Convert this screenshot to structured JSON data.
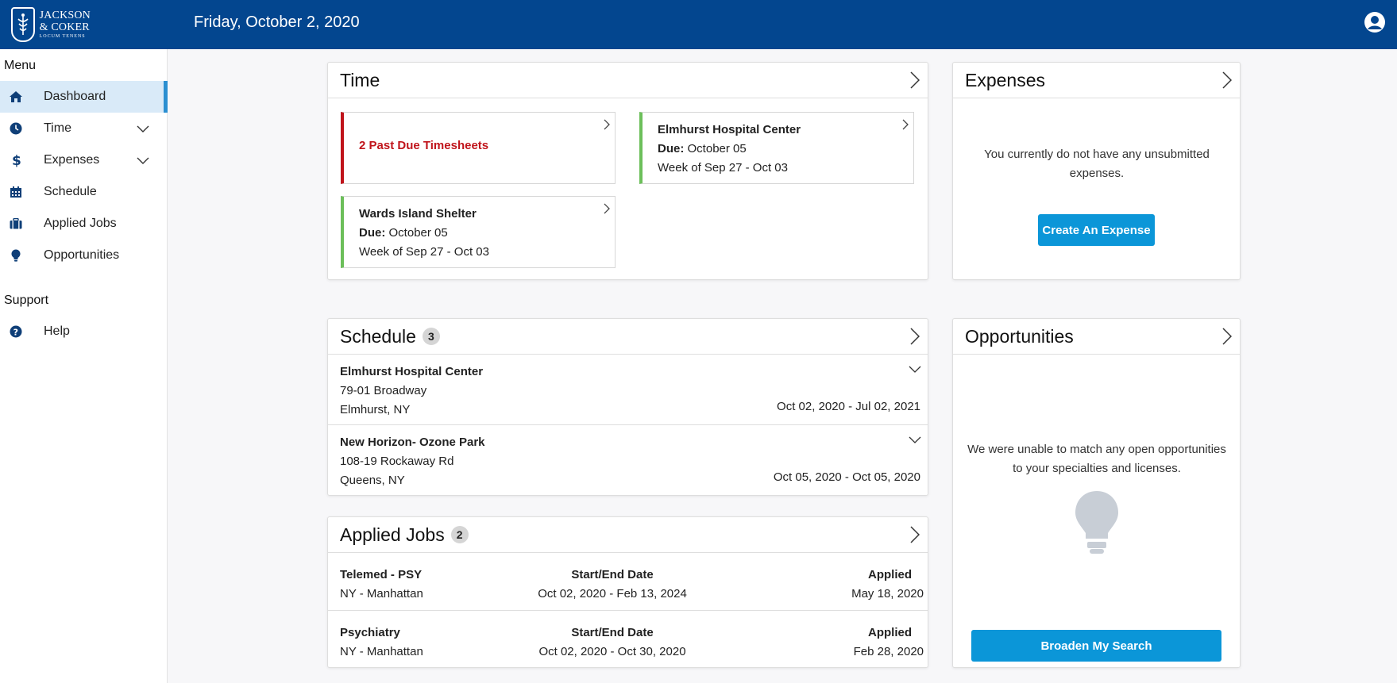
{
  "header": {
    "logo_line1": "JACKSON",
    "logo_line2": "& COKER",
    "logo_line3": "LOCUM TENENS",
    "date": "Friday, October 2, 2020"
  },
  "sidebar": {
    "menu_title": "Menu",
    "items": [
      {
        "label": "Dashboard",
        "icon": "home-icon"
      },
      {
        "label": "Time",
        "icon": "clock-icon"
      },
      {
        "label": "Expenses",
        "icon": "dollar-icon"
      },
      {
        "label": "Schedule",
        "icon": "calendar-icon"
      },
      {
        "label": "Applied Jobs",
        "icon": "briefcase-icon"
      },
      {
        "label": "Opportunities",
        "icon": "lightbulb-icon"
      }
    ],
    "support_title": "Support",
    "support_items": [
      {
        "label": "Help",
        "icon": "help-icon"
      }
    ]
  },
  "time": {
    "title": "Time",
    "past_due": "2 Past Due Timesheets",
    "tiles": [
      {
        "name": "Elmhurst Hospital Center",
        "due_label": "Due:",
        "due": "October 05",
        "week": "Week of Sep 27 - Oct 03"
      },
      {
        "name": "Wards Island Shelter",
        "due_label": "Due:",
        "due": "October 05",
        "week": "Week of Sep 27 - Oct 03"
      }
    ]
  },
  "expenses": {
    "title": "Expenses",
    "message": "You currently do not have any unsubmitted expenses.",
    "button": "Create An Expense"
  },
  "schedule": {
    "title": "Schedule",
    "count": "3",
    "rows": [
      {
        "name": "Elmhurst Hospital Center",
        "address": "79-01 Broadway",
        "city": "Elmhurst, NY",
        "dates": "Oct 02, 2020 - Jul 02, 2021"
      },
      {
        "name": "New Horizon- Ozone Park",
        "address": "108-19 Rockaway Rd",
        "city": "Queens, NY",
        "dates": "Oct 05, 2020 - Oct 05, 2020"
      }
    ]
  },
  "applied_jobs": {
    "title": "Applied Jobs",
    "count": "2",
    "rows": [
      {
        "title": "Telemed - PSY",
        "location": "NY - Manhattan",
        "dates_label": "Start/End Date",
        "dates": "Oct 02, 2020 - Feb 13, 2024",
        "applied_label": "Applied",
        "applied": "May 18, 2020"
      },
      {
        "title": "Psychiatry",
        "location": "NY - Manhattan",
        "dates_label": "Start/End Date",
        "dates": "Oct 02, 2020 - Oct 30, 2020",
        "applied_label": "Applied",
        "applied": "Feb 28, 2020"
      }
    ]
  },
  "opportunities": {
    "title": "Opportunities",
    "message": "We were unable to match any open opportunities to your specialties and licenses.",
    "button": "Broaden My Search"
  },
  "colors": {
    "header_bg": "#03468f",
    "accent": "#0b96d8",
    "past_due": "#c0141b",
    "ok": "#6cbf5a",
    "active_nav": "#d9eaf8"
  }
}
